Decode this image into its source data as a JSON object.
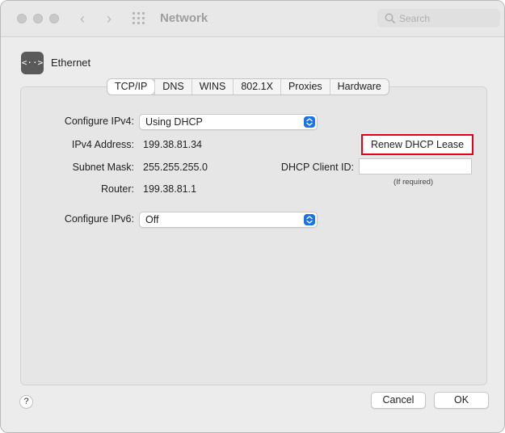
{
  "toolbar": {
    "title": "Network",
    "back_glyph": "‹",
    "forward_glyph": "›",
    "search_placeholder": "Search"
  },
  "header": {
    "service_name": "Ethernet",
    "service_icon_glyph": "<··>",
    "icon": "ethernet-icon"
  },
  "tabs": [
    {
      "label": "TCP/IP",
      "active": true
    },
    {
      "label": "DNS",
      "active": false
    },
    {
      "label": "WINS",
      "active": false
    },
    {
      "label": "802.1X",
      "active": false
    },
    {
      "label": "Proxies",
      "active": false
    },
    {
      "label": "Hardware",
      "active": false
    }
  ],
  "tcpip": {
    "configure_ipv4_label": "Configure IPv4:",
    "configure_ipv4_value": "Using DHCP",
    "ipv4_address_label": "IPv4 Address:",
    "ipv4_address_value": "199.38.81.34",
    "subnet_mask_label": "Subnet Mask:",
    "subnet_mask_value": "255.255.255.0",
    "router_label": "Router:",
    "router_value": "199.38.81.1",
    "renew_button_label": "Renew DHCP Lease",
    "dhcp_client_id_label": "DHCP Client ID:",
    "dhcp_client_id_value": "",
    "dhcp_client_id_hint": "(If required)",
    "configure_ipv6_label": "Configure IPv6:",
    "configure_ipv6_value": "Off"
  },
  "footer": {
    "help_label": "?",
    "cancel_label": "Cancel",
    "ok_label": "OK"
  },
  "colors": {
    "highlight_border": "#e8001b",
    "popup_accent": "#1a73e8"
  }
}
